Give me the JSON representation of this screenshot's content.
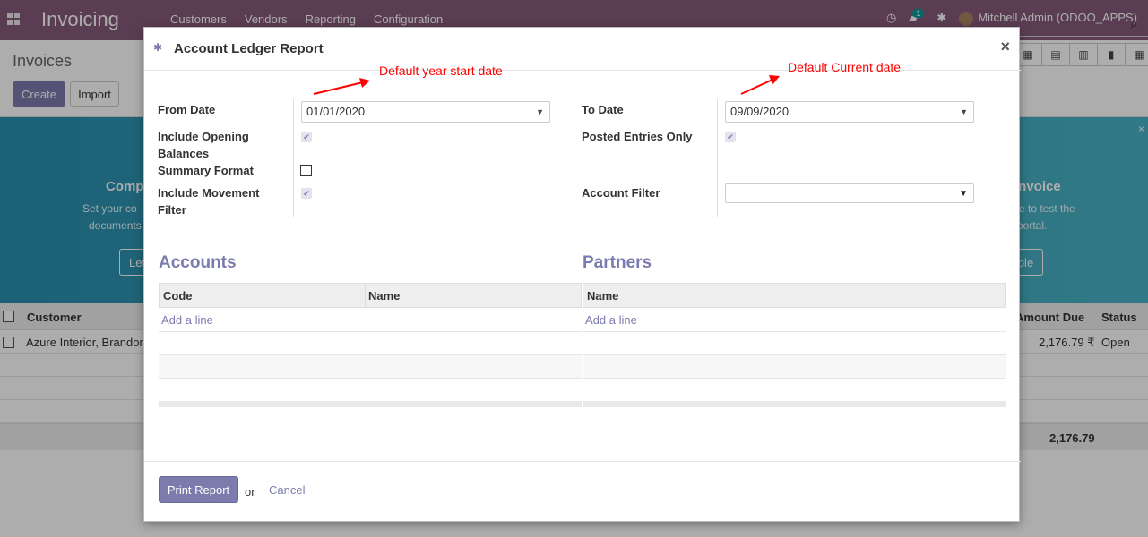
{
  "app": {
    "name": "Invoicing",
    "menu": [
      "Customers",
      "Vendors",
      "Reporting",
      "Configuration"
    ],
    "chat_badge": "1",
    "user": "Mitchell Admin (ODOO_APPS)"
  },
  "control_panel": {
    "title": "Invoices",
    "create_label": "Create",
    "import_label": "Import"
  },
  "banner": {
    "left_title_fragment": "Comp",
    "left_line1_fragment": "Set your co",
    "left_line2_fragment": "documents",
    "left_button_fragment": "Let",
    "right_title_fragment": "Invoice",
    "right_line1_fragment": "e to test the",
    "right_line2_fragment": "portal.",
    "right_button_fragment": "mple",
    "close_glyph": "×"
  },
  "list": {
    "col_customer": "Customer",
    "col_amount_due": "Amount Due",
    "col_status": "Status",
    "row_customer": "Azure Interior, Brandon",
    "row_amount": "2,176.79 ₹",
    "row_status": "Open",
    "total": "2,176.79"
  },
  "modal": {
    "title": "Account Ledger Report",
    "close_glyph": "×",
    "annotation_left": "Default year start date",
    "annotation_right": "Default Current date",
    "from_date_label": "From Date",
    "from_date_value": "01/01/2020",
    "to_date_label": "To Date",
    "to_date_value": "09/09/2020",
    "include_opening_label_l1": "Include Opening",
    "include_opening_label_l2": "Balances",
    "include_opening_checked": true,
    "posted_entries_label": "Posted Entries Only",
    "posted_entries_checked": true,
    "summary_format_label": "Summary Format",
    "summary_format_checked": false,
    "include_movement_label_l1": "Include Movement",
    "include_movement_label_l2": "Filter",
    "include_movement_checked": true,
    "account_filter_label": "Account Filter",
    "account_filter_value": "",
    "accounts_title": "Accounts",
    "accounts_col_code": "Code",
    "accounts_col_name": "Name",
    "partners_title": "Partners",
    "partners_col_name": "Name",
    "add_line": "Add a line",
    "print_label": "Print Report",
    "or_text": "or",
    "cancel_label": "Cancel"
  },
  "colors": {
    "brand": "#875a7b",
    "accent": "#7c7bad",
    "annotation": "#ff0000"
  },
  "icons": {
    "apps": "apps-grid-icon",
    "clock": "clock-icon",
    "chat": "chat-icon",
    "bug": "bug-icon",
    "search": "search-icon",
    "caret": "caret-down-icon"
  }
}
